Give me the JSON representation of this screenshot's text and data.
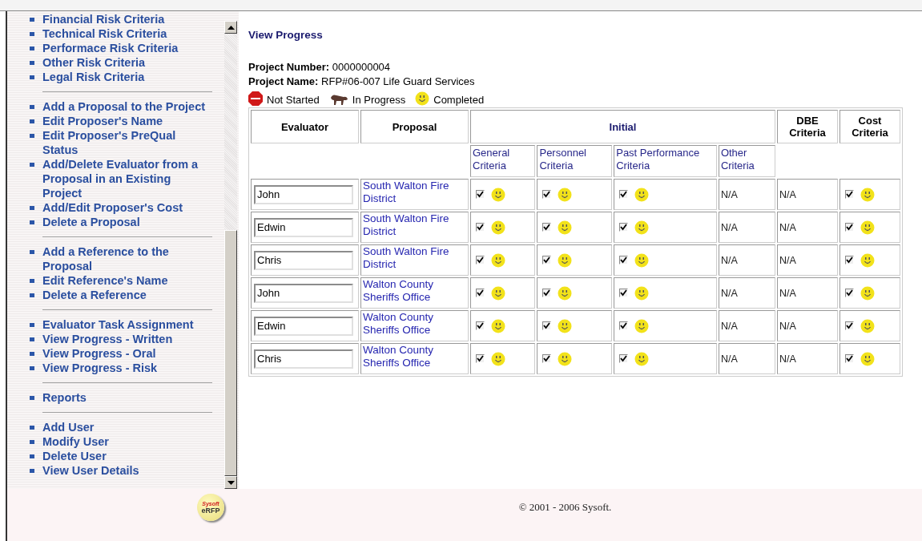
{
  "sidebar": {
    "groups": [
      {
        "items": [
          "Financial Risk Criteria",
          "Technical Risk Criteria",
          "Performace Risk Criteria",
          "Other Risk Criteria",
          "Legal Risk Criteria"
        ]
      },
      {
        "items": [
          "Add a Proposal to the Project",
          "Edit Proposer's Name",
          "Edit Proposer's PreQual Status",
          "Add/Delete Evaluator from a Proposal in an Existing Project",
          "Add/Edit Proposer's Cost",
          "Delete a Proposal"
        ]
      },
      {
        "items": [
          "Add a Reference to the Proposal",
          "Edit Reference's Name",
          "Delete a Reference"
        ]
      },
      {
        "items": [
          "Evaluator Task Assignment",
          "View Progress - Written",
          "View Progress - Oral",
          "View Progress - Risk"
        ]
      },
      {
        "items": [
          "Reports"
        ]
      },
      {
        "items": [
          "Add User",
          "Modify User",
          "Delete User",
          "View User Details"
        ]
      }
    ]
  },
  "page_title": "View Progress",
  "project": {
    "number_label": "Project Number:",
    "number": "0000000004",
    "name_label": "Project Name:",
    "name": "RFP#06-007 Life Guard Services"
  },
  "legend": [
    {
      "kind": "unstarted",
      "label": "Not Started"
    },
    {
      "kind": "started",
      "label": "In Progress"
    },
    {
      "kind": "done",
      "label": "Completed"
    }
  ],
  "table": {
    "columns": [
      "Evaluator",
      "Proposal"
    ],
    "group_heading": "Initial",
    "extra_columns": [
      "DBE Criteria",
      "Cost Criteria"
    ],
    "subcolumns": [
      "General Criteria",
      "Personnel Criteria",
      "Past Performance Criteria",
      "Other Criteria"
    ],
    "rows": [
      {
        "evaluator": "John",
        "proposal": "South Walton Fire District",
        "cells": [
          {
            "kind": "done",
            "checked": true
          },
          {
            "kind": "done",
            "checked": true
          },
          {
            "kind": "done",
            "checked": true
          },
          {
            "kind": "text",
            "text": "N/A"
          },
          {
            "kind": "text",
            "text": "N/A"
          },
          {
            "kind": "done",
            "checked": true
          }
        ]
      },
      {
        "evaluator": "Edwin",
        "proposal": "South Walton Fire District",
        "cells": [
          {
            "kind": "done",
            "checked": true
          },
          {
            "kind": "done",
            "checked": true
          },
          {
            "kind": "done",
            "checked": true
          },
          {
            "kind": "text",
            "text": "N/A"
          },
          {
            "kind": "text",
            "text": "N/A"
          },
          {
            "kind": "done",
            "checked": true
          }
        ]
      },
      {
        "evaluator": "Chris",
        "proposal": "South Walton Fire District",
        "cells": [
          {
            "kind": "done",
            "checked": true
          },
          {
            "kind": "done",
            "checked": true
          },
          {
            "kind": "done",
            "checked": true
          },
          {
            "kind": "text",
            "text": "N/A"
          },
          {
            "kind": "text",
            "text": "N/A"
          },
          {
            "kind": "done",
            "checked": true
          }
        ]
      },
      {
        "evaluator": "John",
        "proposal": "Walton County Sheriffs Office",
        "cells": [
          {
            "kind": "done",
            "checked": true
          },
          {
            "kind": "done",
            "checked": true
          },
          {
            "kind": "done",
            "checked": true
          },
          {
            "kind": "text",
            "text": "N/A"
          },
          {
            "kind": "text",
            "text": "N/A"
          },
          {
            "kind": "done",
            "checked": true
          }
        ]
      },
      {
        "evaluator": "Edwin",
        "proposal": "Walton County Sheriffs Office",
        "cells": [
          {
            "kind": "done",
            "checked": true
          },
          {
            "kind": "done",
            "checked": true
          },
          {
            "kind": "done",
            "checked": true
          },
          {
            "kind": "text",
            "text": "N/A"
          },
          {
            "kind": "text",
            "text": "N/A"
          },
          {
            "kind": "done",
            "checked": true
          }
        ]
      },
      {
        "evaluator": "Chris",
        "proposal": "Walton County Sheriffs Office",
        "cells": [
          {
            "kind": "done",
            "checked": true
          },
          {
            "kind": "done",
            "checked": true
          },
          {
            "kind": "done",
            "checked": true
          },
          {
            "kind": "text",
            "text": "N/A"
          },
          {
            "kind": "text",
            "text": "N/A"
          },
          {
            "kind": "done",
            "checked": true
          }
        ]
      }
    ]
  },
  "logo": {
    "line1": "Sysoft",
    "line2": "eRFP"
  },
  "footer": "© 2001 - 2006 Sysoft."
}
